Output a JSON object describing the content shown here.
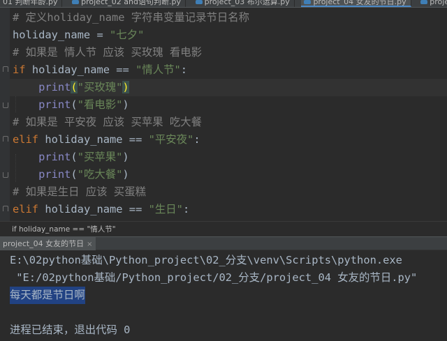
{
  "tabs": [
    {
      "label": "01 判断年龄.py",
      "active": false
    },
    {
      "label": "project_02 and语句判断.py",
      "active": false
    },
    {
      "label": "project_03 布尔运算.py",
      "active": false
    },
    {
      "label": "project_04 女友的节日.py",
      "active": true
    },
    {
      "label": "proje",
      "active": false
    }
  ],
  "code": {
    "l1": "# 定义holiday_name 字符串变量记录节日名称",
    "l2_var": "holiday_name",
    "l2_op": " = ",
    "l2_str": "\"七夕\"",
    "l3": "# 如果是 情人节 应该 买玫瑰 看电影",
    "l4_kw": "if",
    "l4_var": " holiday_name == ",
    "l4_str": "\"情人节\"",
    "l4_end": ":",
    "l5_fn": "print",
    "l5_open": "(",
    "l5_str": "\"买玫瑰\"",
    "l5_close": ")",
    "l6_fn": "print",
    "l6_open": "(",
    "l6_str": "\"看电影\"",
    "l6_close": ")",
    "l7": "# 如果是 平安夜 应该 买苹果 吃大餐",
    "l8_kw": "elif",
    "l8_var": " holiday_name == ",
    "l8_str": "\"平安夜\"",
    "l8_end": ":",
    "l9_fn": "print",
    "l9_open": "(",
    "l9_str": "\"买苹果\"",
    "l9_close": ")",
    "l10_fn": "print",
    "l10_open": "(",
    "l10_str": "\"吃大餐\"",
    "l10_close": ")",
    "l11": "# 如果是生日 应该 买蛋糕",
    "l12_kw": "elif",
    "l12_var": " holiday_name == ",
    "l12_str": "\"生日\"",
    "l12_end": ":"
  },
  "breadcrumb": "if holiday_name == \"情人节\"",
  "run_tab": {
    "label": "project_04 女友的节日",
    "close": "×"
  },
  "console": {
    "cmd1": "E:\\02python基础\\Python_project\\02_分支\\venv\\Scripts\\python.exe",
    "cmd2": " \"E:/02python基础/Python_project/02_分支/project_04 女友的节日.py\"",
    "output": "每天都是节日啊",
    "exit": "进程已结束，退出代码 0"
  },
  "colors": {
    "background": "#2b2b2b",
    "comment": "#808080",
    "keyword": "#cc7832",
    "string": "#6a8759",
    "builtin": "#8888c6",
    "selection": "#214283"
  }
}
